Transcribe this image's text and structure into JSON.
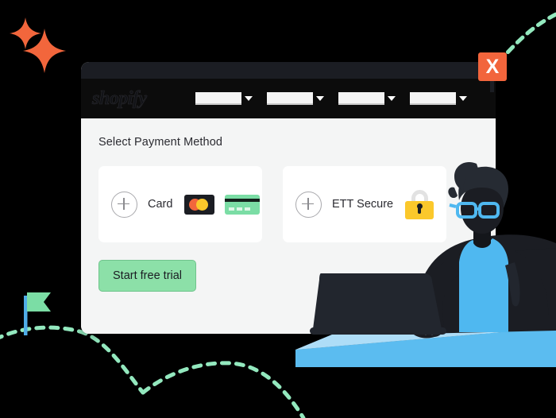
{
  "scene": {
    "background_color": "#000000",
    "description": "Illustration of a person at a laptop beside a browser window showing a payment method selection screen"
  },
  "browser": {
    "titlebar_color": "#1B1D23",
    "navbar_color": "#0C0C0C",
    "logo_text": "shopify",
    "nav_dropdowns": [
      {
        "label": "",
        "icon": "chevron-down-icon"
      },
      {
        "label": "",
        "icon": "chevron-down-icon"
      },
      {
        "label": "",
        "icon": "chevron-down-icon"
      },
      {
        "label": "",
        "icon": "chevron-down-icon"
      }
    ]
  },
  "close_button": {
    "label": "X",
    "color": "#F2653C",
    "icon": "close-icon"
  },
  "page": {
    "title": "Select Payment Method",
    "background_color": "#F4F5F5"
  },
  "payment_methods": [
    {
      "label": "Card",
      "add_icon": "plus-circle-icon",
      "brand_icons": [
        "mastercard-icon",
        "credit-card-icon"
      ],
      "mastercard_colors": [
        "#F2663C",
        "#FBC82B"
      ],
      "credit_card_color": "#7BDDA5"
    },
    {
      "label": "ETT Secure",
      "add_icon": "plus-circle-icon",
      "brand_icons": [
        "padlock-icon"
      ],
      "padlock_color": "#FBC82B"
    }
  ],
  "cta": {
    "label": "Start free trial",
    "color": "#8CE0A8"
  },
  "decorations": {
    "sparkles": {
      "count": 2,
      "color": "#F2663C",
      "icon": "sparkle-icon"
    },
    "flag": {
      "flag_color": "#7BDDA5",
      "pole_color": "#4FADE8",
      "icon": "flag-icon"
    },
    "dashed_paths": {
      "color": "#93E8BE",
      "count": 2,
      "icon": "dashed-arc-icon"
    }
  },
  "illustration": {
    "person": {
      "skin_color": "#1B1D23",
      "hair_color": "#262B33",
      "glasses_color": "#4FB8F0",
      "shirt_color": "#4FB8F0",
      "jacket_color": "#1B1D23",
      "icon": "person-illustration"
    },
    "laptop": {
      "color": "#22262E",
      "icon": "laptop-icon"
    },
    "desk": {
      "top_color": "#AEDDF7",
      "edge_color": "#5BBCF0",
      "icon": "desk-icon"
    }
  }
}
